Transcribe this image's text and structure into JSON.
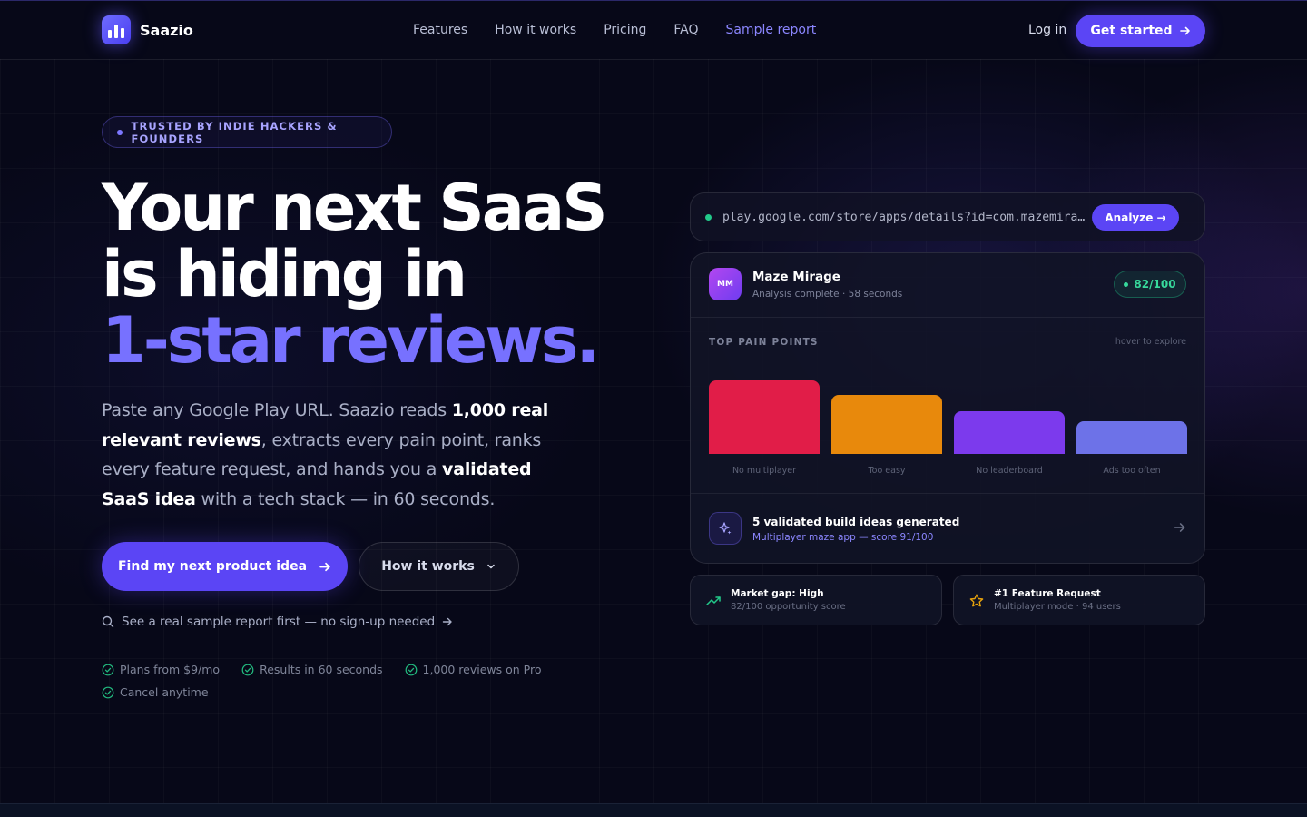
{
  "nav": {
    "brand": "Saazio",
    "links": [
      "Features",
      "How it works",
      "Pricing",
      "FAQ",
      "Sample report"
    ],
    "login": "Log in",
    "get_started": "Get started"
  },
  "hero": {
    "badge": "TRUSTED BY INDIE HACKERS & FOUNDERS",
    "headline_line1": "Your next SaaS",
    "headline_line2": "is hiding in",
    "headline_accent": "1-star reviews.",
    "sub_1": "Paste any Google Play URL. Saazio reads ",
    "sub_b1": "1,000 real relevant reviews",
    "sub_2": ", extracts every pain point, ranks every feature request, and hands you a ",
    "sub_b2": "validated SaaS idea",
    "sub_3": " with a tech stack — in 60 seconds.",
    "cta_primary": "Find my next product idea",
    "cta_secondary": "How it works",
    "sample_link": "See a real sample report first — no sign-up needed",
    "checks": [
      "Plans from $9/mo",
      "Results in 60 seconds",
      "1,000 reviews on Pro",
      "Cancel anytime"
    ]
  },
  "demo": {
    "url": "play.google.com/store/apps/details?id=com.mazemirage.game",
    "analyze": "Analyze →",
    "app_initials": "MM",
    "app_name": "Maze Mirage",
    "app_status": "Analysis complete · 58 seconds",
    "score": "82/100",
    "pain_title": "TOP PAIN POINTS",
    "pain_hint": "hover to explore",
    "ideas_title": "5 validated build ideas generated",
    "ideas_sub": "Multiplayer maze app — score 91/100",
    "mini1_title": "Market gap: High",
    "mini1_sub": "82/100 opportunity score",
    "mini2_title": "#1 Feature Request",
    "mini2_sub": "Multiplayer mode · 94 users"
  },
  "chart_data": {
    "type": "bar",
    "title": "TOP PAIN POINTS",
    "categories": [
      "No multiplayer",
      "Too easy",
      "No leaderboard",
      "Ads too often"
    ],
    "values": [
      100,
      80,
      58,
      45
    ],
    "colors": [
      "#e11d48",
      "#e8890c",
      "#7c3aed",
      "#6d72e8"
    ]
  }
}
